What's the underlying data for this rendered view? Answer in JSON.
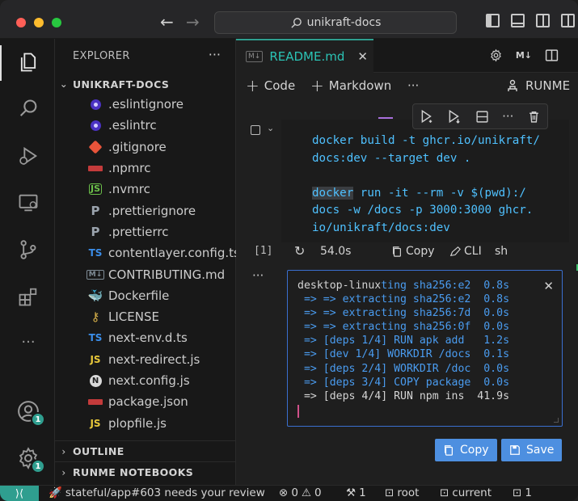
{
  "titlebar": {
    "search_text": "unikraft-docs",
    "icons": [
      "back-arrow-icon",
      "forward-arrow-icon",
      "search-icon",
      "toggle-primary-sidebar-icon",
      "toggle-panel-icon",
      "toggle-secondary-sidebar-icon",
      "customize-layout-icon"
    ]
  },
  "activity": {
    "items": [
      "explorer",
      "search",
      "run-and-debug",
      "remote-explorer",
      "source-control",
      "extensions",
      "more"
    ],
    "accounts_badge": "1",
    "settings_badge": "1"
  },
  "sidebar": {
    "title": "EXPLORER",
    "more": "···",
    "root_folder": "UNIKRAFT-DOCS",
    "files": [
      {
        "name": ".eslintignore",
        "icon": "eslint"
      },
      {
        "name": ".eslintrc",
        "icon": "eslint"
      },
      {
        "name": ".gitignore",
        "icon": "git"
      },
      {
        "name": ".npmrc",
        "icon": "npm"
      },
      {
        "name": ".nvmrc",
        "icon": "node"
      },
      {
        "name": ".prettierignore",
        "icon": "prettier"
      },
      {
        "name": ".prettierrc",
        "icon": "prettier"
      },
      {
        "name": "contentlayer.config.ts",
        "icon": "ts"
      },
      {
        "name": "CONTRIBUTING.md",
        "icon": "markdown"
      },
      {
        "name": "Dockerfile",
        "icon": "docker"
      },
      {
        "name": "LICENSE",
        "icon": "license"
      },
      {
        "name": "next-env.d.ts",
        "icon": "ts"
      },
      {
        "name": "next-redirect.js",
        "icon": "js"
      },
      {
        "name": "next.config.js",
        "icon": "next"
      },
      {
        "name": "package.json",
        "icon": "npm"
      },
      {
        "name": "plopfile.js",
        "icon": "js"
      }
    ],
    "outline": "OUTLINE",
    "runme_notebooks": "RUNME NOTEBOOKS"
  },
  "editor": {
    "tab": {
      "badge": "M↓",
      "label": "README.md"
    },
    "tab_actions": {
      "md_label": "M↓"
    },
    "toolbar": {
      "code": "Code",
      "markdown": "Markdown",
      "more": "···",
      "runme": "RUNME"
    },
    "cell": {
      "exec_count": "[1]",
      "duration": "54.0s",
      "copy": "Copy",
      "cli": "CLI",
      "shell": "sh"
    },
    "output_more": "···",
    "terminal": {
      "lines": [
        {
          "text": "desktop-linux",
          "rest": "ting sha256:e2  0.8s"
        },
        {
          "text": " => => extracting sha256:e2  0.8s"
        },
        {
          "text": " => => extracting sha256:7d  0.0s"
        },
        {
          "text": " => => extracting sha256:0f  0.0s"
        },
        {
          "text": " => [deps 1/4] RUN apk add   1.2s"
        },
        {
          "text": " => [dev 1/4] WORKDIR /docs  0.1s"
        },
        {
          "text": " => [deps 2/4] WORKDIR /doc  0.0s"
        },
        {
          "text": " => [deps 3/4] COPY package  0.0s"
        },
        {
          "text": " => [deps 4/4] RUN npm ins  41.9s"
        }
      ]
    },
    "copy_button": "Copy",
    "save_button": "Save"
  },
  "statusbar": {
    "review": "stateful/app#603 needs your review",
    "errors": "0",
    "warnings": "0",
    "ports": "1",
    "user": "root",
    "cwd": "current",
    "terminals": "1"
  },
  "colors": {
    "accent": "#2f9e8f",
    "terminal_text": "#4a9cf0",
    "button": "#4d8fe0",
    "terminal_border": "#3a6fd0"
  }
}
